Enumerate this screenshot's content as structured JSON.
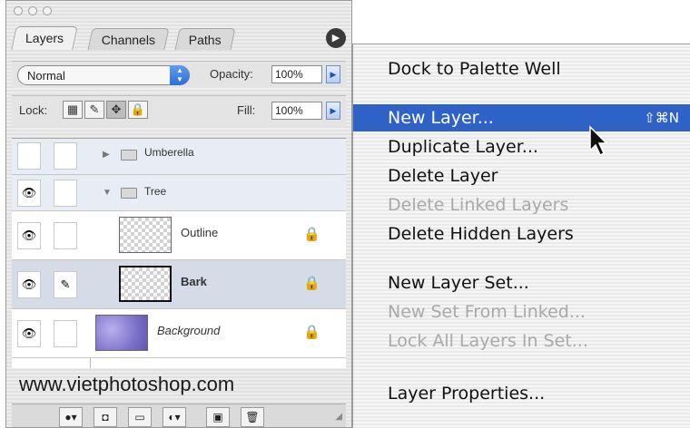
{
  "panel": {
    "tabs": [
      "Layers",
      "Channels",
      "Paths"
    ],
    "blend_mode": "Normal",
    "opacity_label": "Opacity:",
    "opacity_value": "100%",
    "lock_label": "Lock:",
    "fill_label": "Fill:",
    "fill_value": "100%",
    "layers": [
      {
        "name": "Umberella",
        "kind": "set",
        "visible": false,
        "expanded": false
      },
      {
        "name": "Tree",
        "kind": "set",
        "visible": true,
        "expanded": true
      },
      {
        "name": "Outline",
        "kind": "layer",
        "visible": true,
        "locked": true
      },
      {
        "name": "Bark",
        "kind": "layer",
        "visible": true,
        "locked": true,
        "selected": true
      },
      {
        "name": "Background",
        "kind": "layer",
        "visible": true,
        "locked": true
      }
    ],
    "watermark": "www.vietphotoshop.com"
  },
  "menu": {
    "items": [
      {
        "label": "Dock to Palette Well",
        "enabled": true
      },
      {
        "label": "New Layer...",
        "enabled": true,
        "highlighted": true,
        "shortcut": "⇧⌘N"
      },
      {
        "label": "Duplicate Layer...",
        "enabled": true
      },
      {
        "label": "Delete Layer",
        "enabled": true
      },
      {
        "label": "Delete Linked Layers",
        "enabled": false
      },
      {
        "label": "Delete Hidden Layers",
        "enabled": true
      },
      {
        "label": "New Layer Set...",
        "enabled": true
      },
      {
        "label": "New Set From Linked...",
        "enabled": false
      },
      {
        "label": "Lock All Layers In Set...",
        "enabled": false
      },
      {
        "label": "Layer Properties...",
        "enabled": true
      }
    ]
  },
  "colors": {
    "highlight": "#2f62c7",
    "selected_row": "#d5dce8",
    "set_row": "#e8edf5"
  }
}
